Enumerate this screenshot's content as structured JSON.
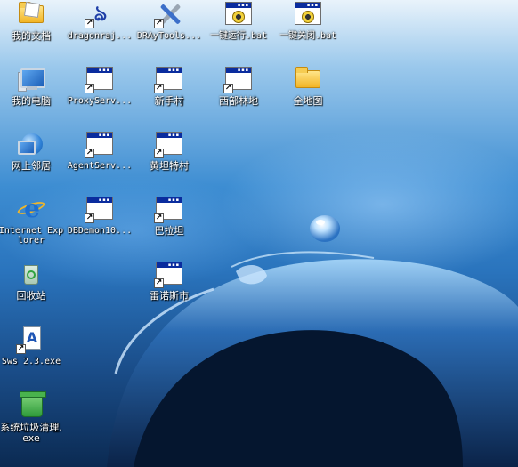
{
  "desktop": {
    "icons": [
      {
        "label": "我的文档",
        "glyph": "folder-documents-icon"
      },
      {
        "label": "dragonraj...",
        "glyph": "dragon-app-icon"
      },
      {
        "label": "DRAyTools...",
        "glyph": "tools-icon"
      },
      {
        "label": "一键运行.bat",
        "glyph": "batch-file-icon"
      },
      {
        "label": "一键关闭.bat",
        "glyph": "batch-file-icon"
      },
      {
        "label": "我的电脑",
        "glyph": "my-computer-icon"
      },
      {
        "label": "ProxyServ...",
        "glyph": "exe-window-icon"
      },
      {
        "label": "新手村",
        "glyph": "exe-window-icon"
      },
      {
        "label": "西部林地",
        "glyph": "exe-window-icon"
      },
      {
        "label": "全地图",
        "glyph": "folder-icon"
      },
      {
        "label": "网上邻居",
        "glyph": "network-places-icon"
      },
      {
        "label": "AgentServ...",
        "glyph": "exe-window-icon"
      },
      {
        "label": "黄坦特村",
        "glyph": "exe-window-icon"
      },
      {
        "label": "Internet Explorer",
        "glyph": "internet-explorer-icon"
      },
      {
        "label": "DBDemon10...",
        "glyph": "exe-window-icon"
      },
      {
        "label": "巴拉坦",
        "glyph": "exe-window-icon"
      },
      {
        "label": "回收站",
        "glyph": "recycle-bin-icon"
      },
      {
        "label": "雷诺斯市",
        "glyph": "exe-window-icon"
      },
      {
        "label": "Sws 2.3.exe",
        "glyph": "sws-exe-icon"
      },
      {
        "label": "系统垃圾清理.exe",
        "glyph": "cleaner-exe-icon"
      }
    ]
  }
}
